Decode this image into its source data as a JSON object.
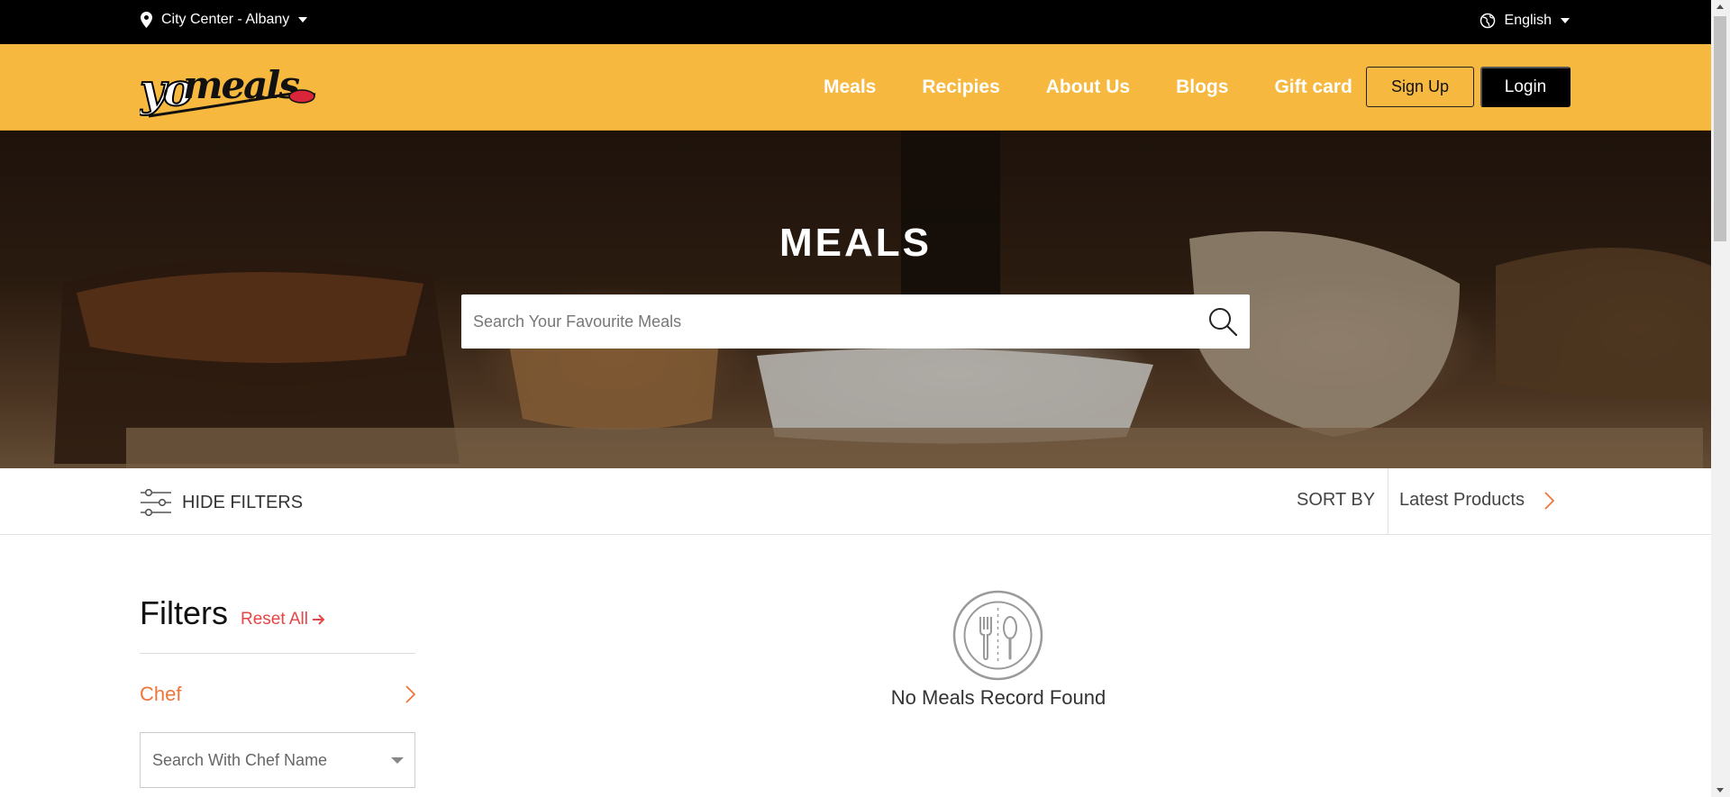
{
  "topbar": {
    "location": "City Center - Albany",
    "language": "English"
  },
  "header": {
    "logo_text": "yomeals",
    "nav": [
      "Meals",
      "Recipies",
      "About Us",
      "Blogs",
      "Gift card"
    ],
    "signup_label": "Sign Up",
    "login_label": "Login"
  },
  "hero": {
    "title": "MEALS",
    "search_placeholder": "Search Your Favourite Meals"
  },
  "toolbar": {
    "hide_filters_label": "HIDE FILTERS",
    "sort_by_label": "SORT BY",
    "sort_value": "Latest Products"
  },
  "filters": {
    "title": "Filters",
    "reset_label": "Reset All",
    "chef_label": "Chef",
    "chef_placeholder": "Search With Chef Name"
  },
  "results": {
    "empty_message": "No Meals Record Found"
  },
  "colors": {
    "header_bg": "#f6b83e",
    "accent_orange": "#f0753a",
    "reset_red": "#e84545",
    "topbar_bg": "#000000"
  }
}
